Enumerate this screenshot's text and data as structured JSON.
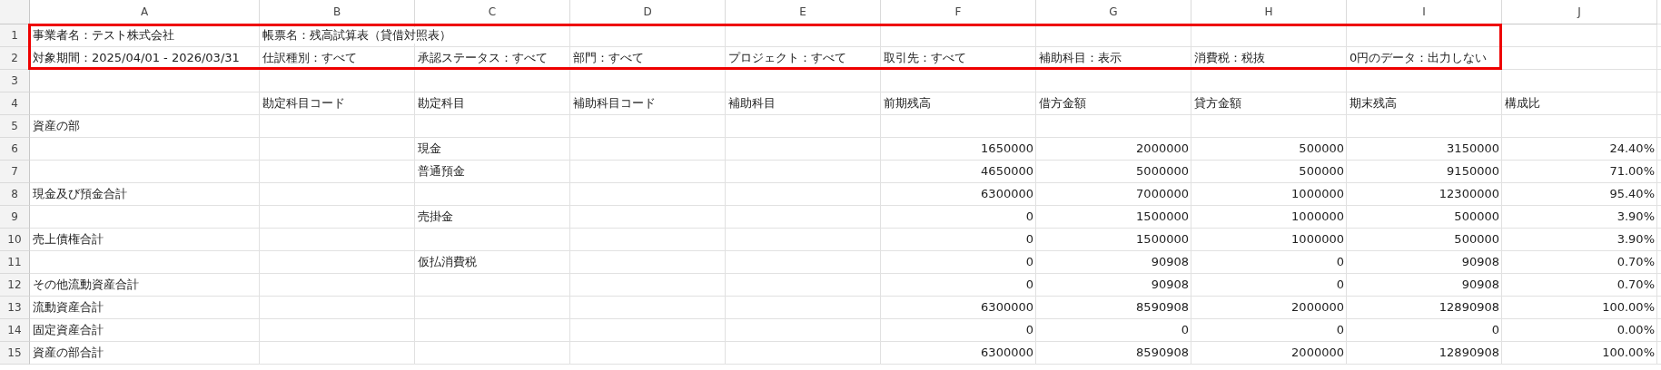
{
  "columns": [
    "A",
    "B",
    "C",
    "D",
    "E",
    "F",
    "G",
    "H",
    "I",
    "J"
  ],
  "rows": [
    {
      "number": "1",
      "outlined": true,
      "cells": {
        "A": {
          "kind": "text",
          "text": "事業者名：テスト株式会社"
        },
        "B": {
          "kind": "text",
          "text": "帳票名：残高試算表（貸借対照表）"
        }
      }
    },
    {
      "number": "2",
      "outlined": true,
      "cells": {
        "A": {
          "kind": "text",
          "text": "対象期間：2025/04/01 - 2026/03/31"
        },
        "B": {
          "kind": "text",
          "text": "仕訳種別：すべて"
        },
        "C": {
          "kind": "text",
          "text": "承認ステータス：すべて"
        },
        "D": {
          "kind": "text",
          "text": "部門：すべて"
        },
        "E": {
          "kind": "text",
          "text": "プロジェクト：すべて"
        },
        "F": {
          "kind": "text",
          "text": "取引先：すべて"
        },
        "G": {
          "kind": "text",
          "text": "補助科目：表示"
        },
        "H": {
          "kind": "text",
          "text": "消費税：税抜"
        },
        "I": {
          "kind": "text",
          "text": "0円のデータ：出力しない"
        }
      }
    },
    {
      "number": "3",
      "outlined": false
    },
    {
      "number": "4",
      "outlined": false,
      "cells": {
        "B": {
          "kind": "text",
          "text": "勘定科目コード"
        },
        "C": {
          "kind": "text",
          "text": "勘定科目"
        },
        "D": {
          "kind": "text",
          "text": "補助科目コード"
        },
        "E": {
          "kind": "text",
          "text": "補助科目"
        },
        "F": {
          "kind": "text",
          "text": "前期残高"
        },
        "G": {
          "kind": "text",
          "text": "借方金額"
        },
        "H": {
          "kind": "text",
          "text": "貸方金額"
        },
        "I": {
          "kind": "text",
          "text": "期末残高"
        },
        "J": {
          "kind": "text",
          "text": "構成比"
        }
      }
    },
    {
      "number": "5",
      "outlined": false,
      "cells": {
        "A": {
          "kind": "text",
          "text": "資産の部"
        }
      }
    },
    {
      "number": "6",
      "outlined": false,
      "cells": {
        "C": {
          "kind": "text",
          "text": "現金"
        },
        "F": {
          "kind": "number",
          "text": "1650000"
        },
        "G": {
          "kind": "number",
          "text": "2000000"
        },
        "H": {
          "kind": "number",
          "text": "500000"
        },
        "I": {
          "kind": "number",
          "text": "3150000"
        },
        "J": {
          "kind": "number",
          "text": "24.40%"
        }
      }
    },
    {
      "number": "7",
      "outlined": false,
      "cells": {
        "C": {
          "kind": "text",
          "text": "普通預金"
        },
        "F": {
          "kind": "number",
          "text": "4650000"
        },
        "G": {
          "kind": "number",
          "text": "5000000"
        },
        "H": {
          "kind": "number",
          "text": "500000"
        },
        "I": {
          "kind": "number",
          "text": "9150000"
        },
        "J": {
          "kind": "number",
          "text": "71.00%"
        }
      }
    },
    {
      "number": "8",
      "outlined": false,
      "cells": {
        "A": {
          "kind": "text",
          "text": "現金及び預金合計"
        },
        "F": {
          "kind": "number",
          "text": "6300000"
        },
        "G": {
          "kind": "number",
          "text": "7000000"
        },
        "H": {
          "kind": "number",
          "text": "1000000"
        },
        "I": {
          "kind": "number",
          "text": "12300000"
        },
        "J": {
          "kind": "number",
          "text": "95.40%"
        }
      }
    },
    {
      "number": "9",
      "outlined": false,
      "cells": {
        "C": {
          "kind": "text",
          "text": "売掛金"
        },
        "F": {
          "kind": "number",
          "text": "0"
        },
        "G": {
          "kind": "number",
          "text": "1500000"
        },
        "H": {
          "kind": "number",
          "text": "1000000"
        },
        "I": {
          "kind": "number",
          "text": "500000"
        },
        "J": {
          "kind": "number",
          "text": "3.90%"
        }
      }
    },
    {
      "number": "10",
      "outlined": false,
      "cells": {
        "A": {
          "kind": "text",
          "text": "売上債権合計"
        },
        "F": {
          "kind": "number",
          "text": "0"
        },
        "G": {
          "kind": "number",
          "text": "1500000"
        },
        "H": {
          "kind": "number",
          "text": "1000000"
        },
        "I": {
          "kind": "number",
          "text": "500000"
        },
        "J": {
          "kind": "number",
          "text": "3.90%"
        }
      }
    },
    {
      "number": "11",
      "outlined": false,
      "cells": {
        "C": {
          "kind": "text",
          "text": "仮払消費税"
        },
        "F": {
          "kind": "number",
          "text": "0"
        },
        "G": {
          "kind": "number",
          "text": "90908"
        },
        "H": {
          "kind": "number",
          "text": "0"
        },
        "I": {
          "kind": "number",
          "text": "90908"
        },
        "J": {
          "kind": "number",
          "text": "0.70%"
        }
      }
    },
    {
      "number": "12",
      "outlined": false,
      "cells": {
        "A": {
          "kind": "text",
          "text": "その他流動資産合計"
        },
        "F": {
          "kind": "number",
          "text": "0"
        },
        "G": {
          "kind": "number",
          "text": "90908"
        },
        "H": {
          "kind": "number",
          "text": "0"
        },
        "I": {
          "kind": "number",
          "text": "90908"
        },
        "J": {
          "kind": "number",
          "text": "0.70%"
        }
      }
    },
    {
      "number": "13",
      "outlined": false,
      "cells": {
        "A": {
          "kind": "text",
          "text": "流動資産合計"
        },
        "F": {
          "kind": "number",
          "text": "6300000"
        },
        "G": {
          "kind": "number",
          "text": "8590908"
        },
        "H": {
          "kind": "number",
          "text": "2000000"
        },
        "I": {
          "kind": "number",
          "text": "12890908"
        },
        "J": {
          "kind": "number",
          "text": "100.00%"
        }
      }
    },
    {
      "number": "14",
      "outlined": false,
      "cells": {
        "A": {
          "kind": "text",
          "text": "固定資産合計"
        },
        "F": {
          "kind": "number",
          "text": "0"
        },
        "G": {
          "kind": "number",
          "text": "0"
        },
        "H": {
          "kind": "number",
          "text": "0"
        },
        "I": {
          "kind": "number",
          "text": "0"
        },
        "J": {
          "kind": "number",
          "text": "0.00%"
        }
      }
    },
    {
      "number": "15",
      "outlined": false,
      "cells": {
        "A": {
          "kind": "text",
          "text": "資産の部合計"
        },
        "F": {
          "kind": "number",
          "text": "6300000"
        },
        "G": {
          "kind": "number",
          "text": "8590908"
        },
        "H": {
          "kind": "number",
          "text": "2000000"
        },
        "I": {
          "kind": "number",
          "text": "12890908"
        },
        "J": {
          "kind": "number",
          "text": "100.00%"
        }
      }
    }
  ]
}
